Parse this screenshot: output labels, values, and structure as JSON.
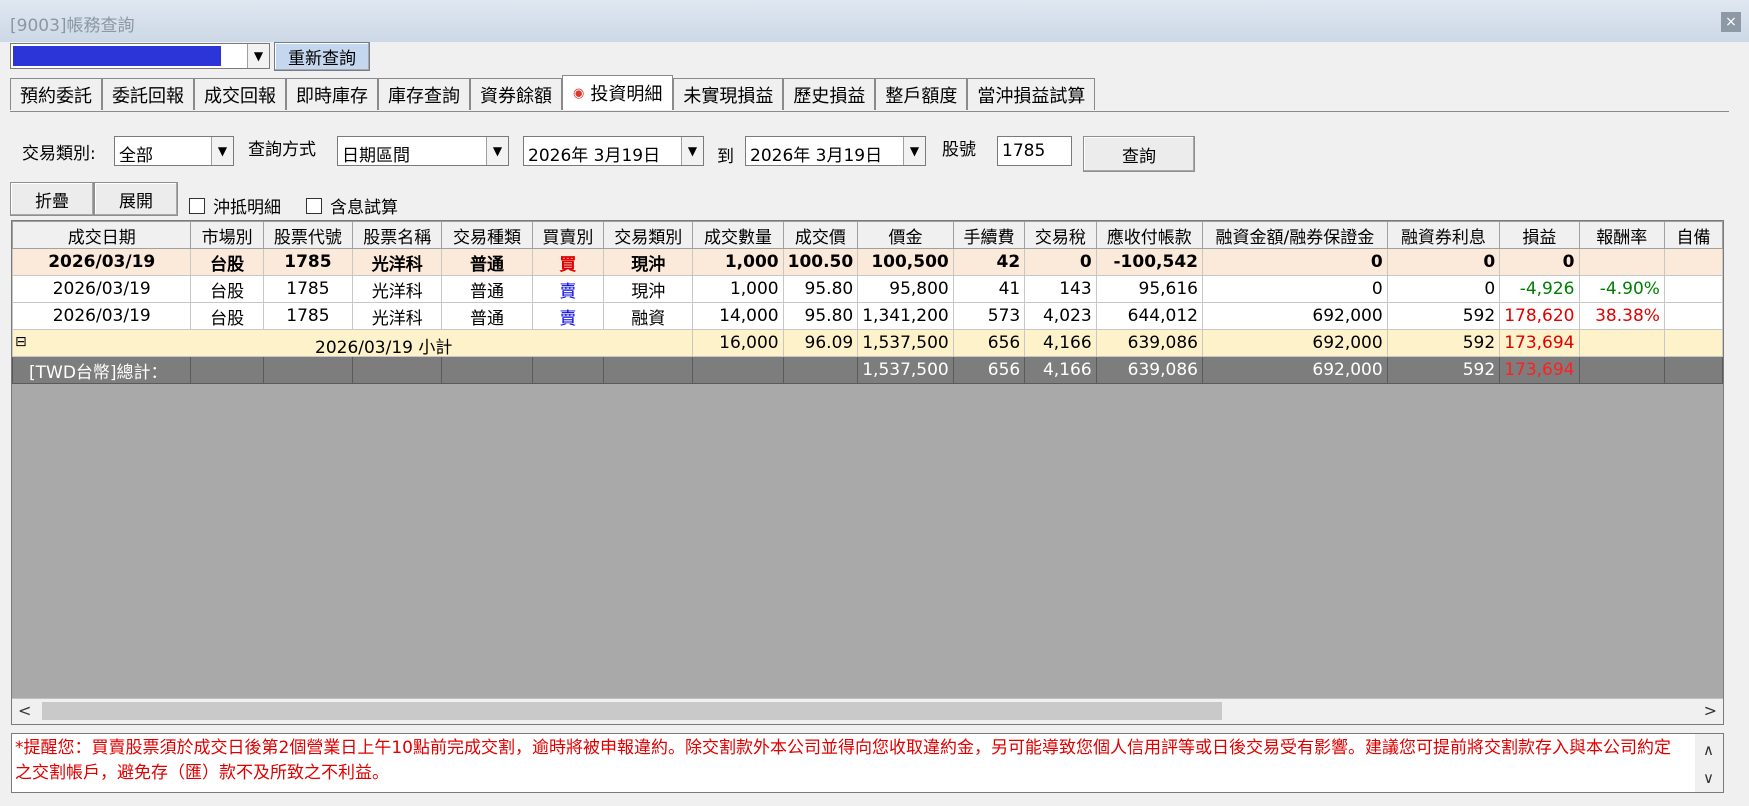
{
  "window": {
    "title": "[9003]帳務查詢",
    "close_label": "×"
  },
  "account_bar": {
    "requery_label": "重新查詢"
  },
  "tabs": [
    {
      "label": "預約委託",
      "active": false
    },
    {
      "label": "委託回報",
      "active": false
    },
    {
      "label": "成交回報",
      "active": false
    },
    {
      "label": "即時庫存",
      "active": false
    },
    {
      "label": "庫存查詢",
      "active": false
    },
    {
      "label": "資券餘額",
      "active": false
    },
    {
      "label": "投資明細",
      "active": true
    },
    {
      "label": "未實現損益",
      "active": false
    },
    {
      "label": "歷史損益",
      "active": false
    },
    {
      "label": "整戶額度",
      "active": false
    },
    {
      "label": "當沖損益試算",
      "active": false
    }
  ],
  "filters": {
    "trade_type_label": "交易類別:",
    "trade_type_value": "全部",
    "query_method_label": "查詢方式",
    "query_method_value": "日期區間",
    "date_from": "2026年 3月19日",
    "to_label": "到",
    "date_to": "2026年 3月19日",
    "stock_no_label": "股號",
    "stock_no_value": "1785",
    "query_label": "查詢"
  },
  "actions": {
    "collapse_label": "折疊",
    "expand_label": "展開",
    "offset_detail_label": "沖抵明細",
    "include_interest_label": "含息試算"
  },
  "grid": {
    "columns": [
      "成交日期",
      "市場別",
      "股票代號",
      "股票名稱",
      "交易種類",
      "買賣別",
      "交易類別",
      "成交數量",
      "成交價",
      "價金",
      "手續費",
      "交易稅",
      "應收付帳款",
      "融資金額/融券保證金",
      "融資券利息",
      "損益",
      "報酬率",
      "自備"
    ],
    "rows": [
      {
        "kind": "bold",
        "date": "2026/03/19",
        "market": "台股",
        "code": "1785",
        "name": "光洋科",
        "kind2": "普通",
        "side": "買",
        "side_color": "red",
        "type": "現沖",
        "qty": "1,000",
        "price": "100.50",
        "amount": "100,500",
        "fee": "42",
        "tax": "0",
        "payable": "-100,542",
        "margin": "0",
        "interest": "0",
        "pl": "0",
        "pl_color": "black",
        "ret": "",
        "ret_color": "black"
      },
      {
        "kind": "normal",
        "date": "2026/03/19",
        "market": "台股",
        "code": "1785",
        "name": "光洋科",
        "kind2": "普通",
        "side": "賣",
        "side_color": "blue",
        "type": "現沖",
        "qty": "1,000",
        "price": "95.80",
        "amount": "95,800",
        "fee": "41",
        "tax": "143",
        "payable": "95,616",
        "margin": "0",
        "interest": "0",
        "pl": "-4,926",
        "pl_color": "green",
        "ret": "-4.90%",
        "ret_color": "green"
      },
      {
        "kind": "normal",
        "date": "2026/03/19",
        "market": "台股",
        "code": "1785",
        "name": "光洋科",
        "kind2": "普通",
        "side": "賣",
        "side_color": "blue",
        "type": "融資",
        "qty": "14,000",
        "price": "95.80",
        "amount": "1,341,200",
        "fee": "573",
        "tax": "4,023",
        "payable": "644,012",
        "margin": "692,000",
        "interest": "592",
        "pl": "178,620",
        "pl_color": "red",
        "ret": "38.38%",
        "ret_color": "red"
      }
    ],
    "subtotal": {
      "toggle": "⊟",
      "label": "2026/03/19 小計",
      "qty": "16,000",
      "price": "96.09",
      "amount": "1,537,500",
      "fee": "656",
      "tax": "4,166",
      "payable": "639,086",
      "margin": "692,000",
      "interest": "592",
      "pl": "173,694"
    },
    "total": {
      "label": "[TWD台幣]總計：",
      "amount": "1,537,500",
      "fee": "656",
      "tax": "4,166",
      "payable": "639,086",
      "margin": "692,000",
      "interest": "592",
      "pl": "173,694"
    }
  },
  "notice": {
    "text": "*提醒您：買賣股票須於成交日後第2個營業日上午10點前完成交割，逾時將被申報違約。除交割款外本公司並得向您收取違約金，另可能導致您個人信用評等或日後交易受有影響。建議您可提前將交割款存入與本公司約定之交割帳戶，避免存（匯）款不及所致之不利益。"
  },
  "colors": {
    "buy": "#e00000",
    "sell": "#0000e0",
    "gain": "#e00000",
    "loss": "#008000",
    "subtotal_bg": "#fdf2c9",
    "total_bg": "#7d7d7d"
  }
}
